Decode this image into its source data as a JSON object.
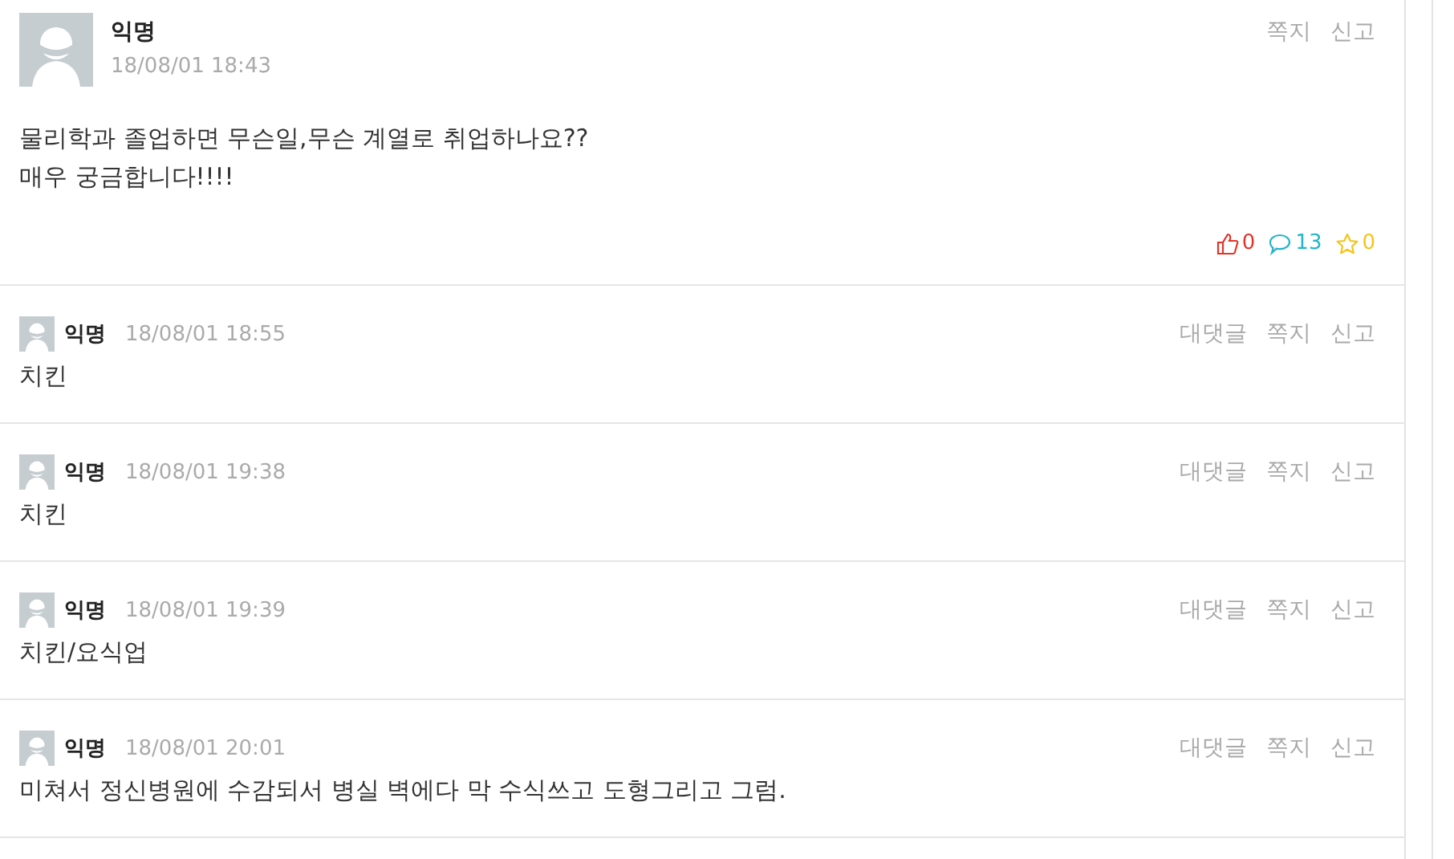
{
  "post": {
    "author": "익명",
    "date": "18/08/01 18:43",
    "actions": [
      "쪽지",
      "신고"
    ],
    "body": [
      "물리학과 졸업하면 무슨일,무슨 계열로 취업하나요??",
      "매우 궁금합니다!!!!"
    ],
    "reactions": [
      {
        "kind": "like",
        "count": "0"
      },
      {
        "kind": "comment",
        "count": "13"
      },
      {
        "kind": "star",
        "count": "0"
      }
    ]
  },
  "comments": [
    {
      "author": "익명",
      "date": "18/08/01 18:55",
      "actions": [
        "대댓글",
        "쪽지",
        "신고"
      ],
      "text": "치킨"
    },
    {
      "author": "익명",
      "date": "18/08/01 19:38",
      "actions": [
        "대댓글",
        "쪽지",
        "신고"
      ],
      "text": "치킨"
    },
    {
      "author": "익명",
      "date": "18/08/01 19:39",
      "actions": [
        "대댓글",
        "쪽지",
        "신고"
      ],
      "text": "치킨/요식업"
    },
    {
      "author": "익명",
      "date": "18/08/01 20:01",
      "actions": [
        "대댓글",
        "쪽지",
        "신고"
      ],
      "text": "미쳐서 정신병원에 수감되서 병실 벽에다 막 수식쓰고 도형그리고 그럼."
    }
  ]
}
